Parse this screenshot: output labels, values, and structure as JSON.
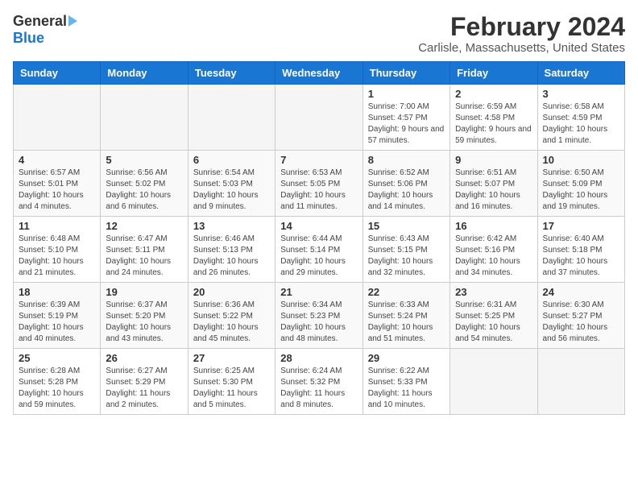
{
  "header": {
    "logo_general": "General",
    "logo_blue": "Blue",
    "title": "February 2024",
    "subtitle": "Carlisle, Massachusetts, United States"
  },
  "weekdays": [
    "Sunday",
    "Monday",
    "Tuesday",
    "Wednesday",
    "Thursday",
    "Friday",
    "Saturday"
  ],
  "weeks": [
    [
      {
        "day": "",
        "info": ""
      },
      {
        "day": "",
        "info": ""
      },
      {
        "day": "",
        "info": ""
      },
      {
        "day": "",
        "info": ""
      },
      {
        "day": "1",
        "info": "Sunrise: 7:00 AM\nSunset: 4:57 PM\nDaylight: 9 hours\nand 57 minutes."
      },
      {
        "day": "2",
        "info": "Sunrise: 6:59 AM\nSunset: 4:58 PM\nDaylight: 9 hours\nand 59 minutes."
      },
      {
        "day": "3",
        "info": "Sunrise: 6:58 AM\nSunset: 4:59 PM\nDaylight: 10 hours\nand 1 minute."
      }
    ],
    [
      {
        "day": "4",
        "info": "Sunrise: 6:57 AM\nSunset: 5:01 PM\nDaylight: 10 hours\nand 4 minutes."
      },
      {
        "day": "5",
        "info": "Sunrise: 6:56 AM\nSunset: 5:02 PM\nDaylight: 10 hours\nand 6 minutes."
      },
      {
        "day": "6",
        "info": "Sunrise: 6:54 AM\nSunset: 5:03 PM\nDaylight: 10 hours\nand 9 minutes."
      },
      {
        "day": "7",
        "info": "Sunrise: 6:53 AM\nSunset: 5:05 PM\nDaylight: 10 hours\nand 11 minutes."
      },
      {
        "day": "8",
        "info": "Sunrise: 6:52 AM\nSunset: 5:06 PM\nDaylight: 10 hours\nand 14 minutes."
      },
      {
        "day": "9",
        "info": "Sunrise: 6:51 AM\nSunset: 5:07 PM\nDaylight: 10 hours\nand 16 minutes."
      },
      {
        "day": "10",
        "info": "Sunrise: 6:50 AM\nSunset: 5:09 PM\nDaylight: 10 hours\nand 19 minutes."
      }
    ],
    [
      {
        "day": "11",
        "info": "Sunrise: 6:48 AM\nSunset: 5:10 PM\nDaylight: 10 hours\nand 21 minutes."
      },
      {
        "day": "12",
        "info": "Sunrise: 6:47 AM\nSunset: 5:11 PM\nDaylight: 10 hours\nand 24 minutes."
      },
      {
        "day": "13",
        "info": "Sunrise: 6:46 AM\nSunset: 5:13 PM\nDaylight: 10 hours\nand 26 minutes."
      },
      {
        "day": "14",
        "info": "Sunrise: 6:44 AM\nSunset: 5:14 PM\nDaylight: 10 hours\nand 29 minutes."
      },
      {
        "day": "15",
        "info": "Sunrise: 6:43 AM\nSunset: 5:15 PM\nDaylight: 10 hours\nand 32 minutes."
      },
      {
        "day": "16",
        "info": "Sunrise: 6:42 AM\nSunset: 5:16 PM\nDaylight: 10 hours\nand 34 minutes."
      },
      {
        "day": "17",
        "info": "Sunrise: 6:40 AM\nSunset: 5:18 PM\nDaylight: 10 hours\nand 37 minutes."
      }
    ],
    [
      {
        "day": "18",
        "info": "Sunrise: 6:39 AM\nSunset: 5:19 PM\nDaylight: 10 hours\nand 40 minutes."
      },
      {
        "day": "19",
        "info": "Sunrise: 6:37 AM\nSunset: 5:20 PM\nDaylight: 10 hours\nand 43 minutes."
      },
      {
        "day": "20",
        "info": "Sunrise: 6:36 AM\nSunset: 5:22 PM\nDaylight: 10 hours\nand 45 minutes."
      },
      {
        "day": "21",
        "info": "Sunrise: 6:34 AM\nSunset: 5:23 PM\nDaylight: 10 hours\nand 48 minutes."
      },
      {
        "day": "22",
        "info": "Sunrise: 6:33 AM\nSunset: 5:24 PM\nDaylight: 10 hours\nand 51 minutes."
      },
      {
        "day": "23",
        "info": "Sunrise: 6:31 AM\nSunset: 5:25 PM\nDaylight: 10 hours\nand 54 minutes."
      },
      {
        "day": "24",
        "info": "Sunrise: 6:30 AM\nSunset: 5:27 PM\nDaylight: 10 hours\nand 56 minutes."
      }
    ],
    [
      {
        "day": "25",
        "info": "Sunrise: 6:28 AM\nSunset: 5:28 PM\nDaylight: 10 hours\nand 59 minutes."
      },
      {
        "day": "26",
        "info": "Sunrise: 6:27 AM\nSunset: 5:29 PM\nDaylight: 11 hours\nand 2 minutes."
      },
      {
        "day": "27",
        "info": "Sunrise: 6:25 AM\nSunset: 5:30 PM\nDaylight: 11 hours\nand 5 minutes."
      },
      {
        "day": "28",
        "info": "Sunrise: 6:24 AM\nSunset: 5:32 PM\nDaylight: 11 hours\nand 8 minutes."
      },
      {
        "day": "29",
        "info": "Sunrise: 6:22 AM\nSunset: 5:33 PM\nDaylight: 11 hours\nand 10 minutes."
      },
      {
        "day": "",
        "info": ""
      },
      {
        "day": "",
        "info": ""
      }
    ]
  ]
}
